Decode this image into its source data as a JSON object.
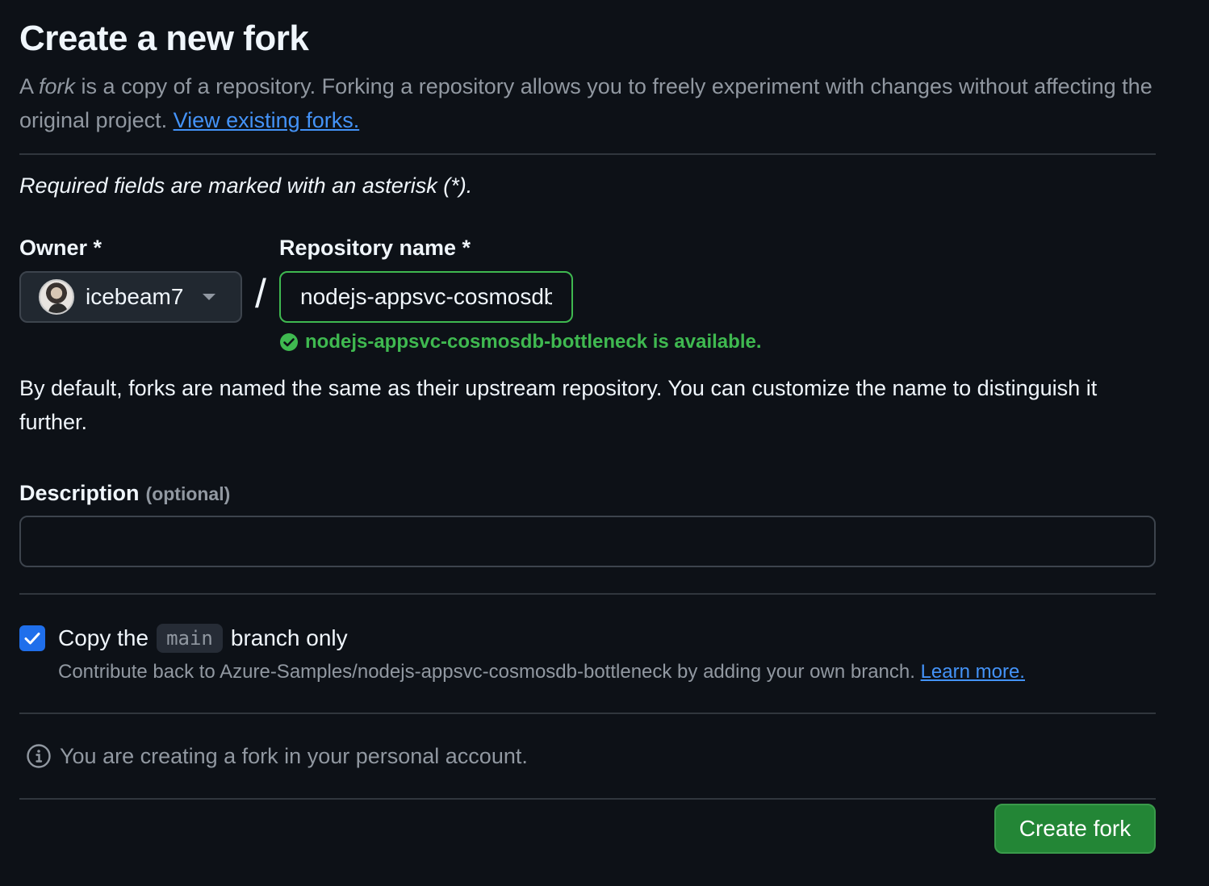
{
  "header": {
    "title": "Create a new fork",
    "subtitle_pre": "A ",
    "subtitle_em": "fork",
    "subtitle_post": " is a copy of a repository. Forking a repository allows you to freely experiment with changes without affecting the original project. ",
    "view_forks_link": "View existing forks."
  },
  "required_note": "Required fields are marked with an asterisk (*).",
  "owner": {
    "label": "Owner *",
    "value": "icebeam7",
    "icon": "chevron-down-icon"
  },
  "separator": "/",
  "repository": {
    "label": "Repository name *",
    "value": "nodejs-appsvc-cosmosdb-bottleneck",
    "availability": "nodejs-appsvc-cosmosdb-bottleneck is available.",
    "status_color": "#3fb950"
  },
  "default_note": "By default, forks are named the same as their upstream repository. You can customize the name to distinguish it further.",
  "description": {
    "label": "Description",
    "optional": "(optional)",
    "value": "",
    "placeholder": ""
  },
  "copy_branch": {
    "checked": true,
    "label_pre": "Copy the",
    "branch": "main",
    "label_post": "branch only",
    "sub_text": "Contribute back to Azure-Samples/nodejs-appsvc-cosmosdb-bottleneck by adding your own branch. ",
    "learn_more": "Learn more."
  },
  "info": {
    "icon": "info-icon",
    "text": "You are creating a fork in your personal account."
  },
  "actions": {
    "create_label": "Create fork",
    "color": "#238636"
  }
}
